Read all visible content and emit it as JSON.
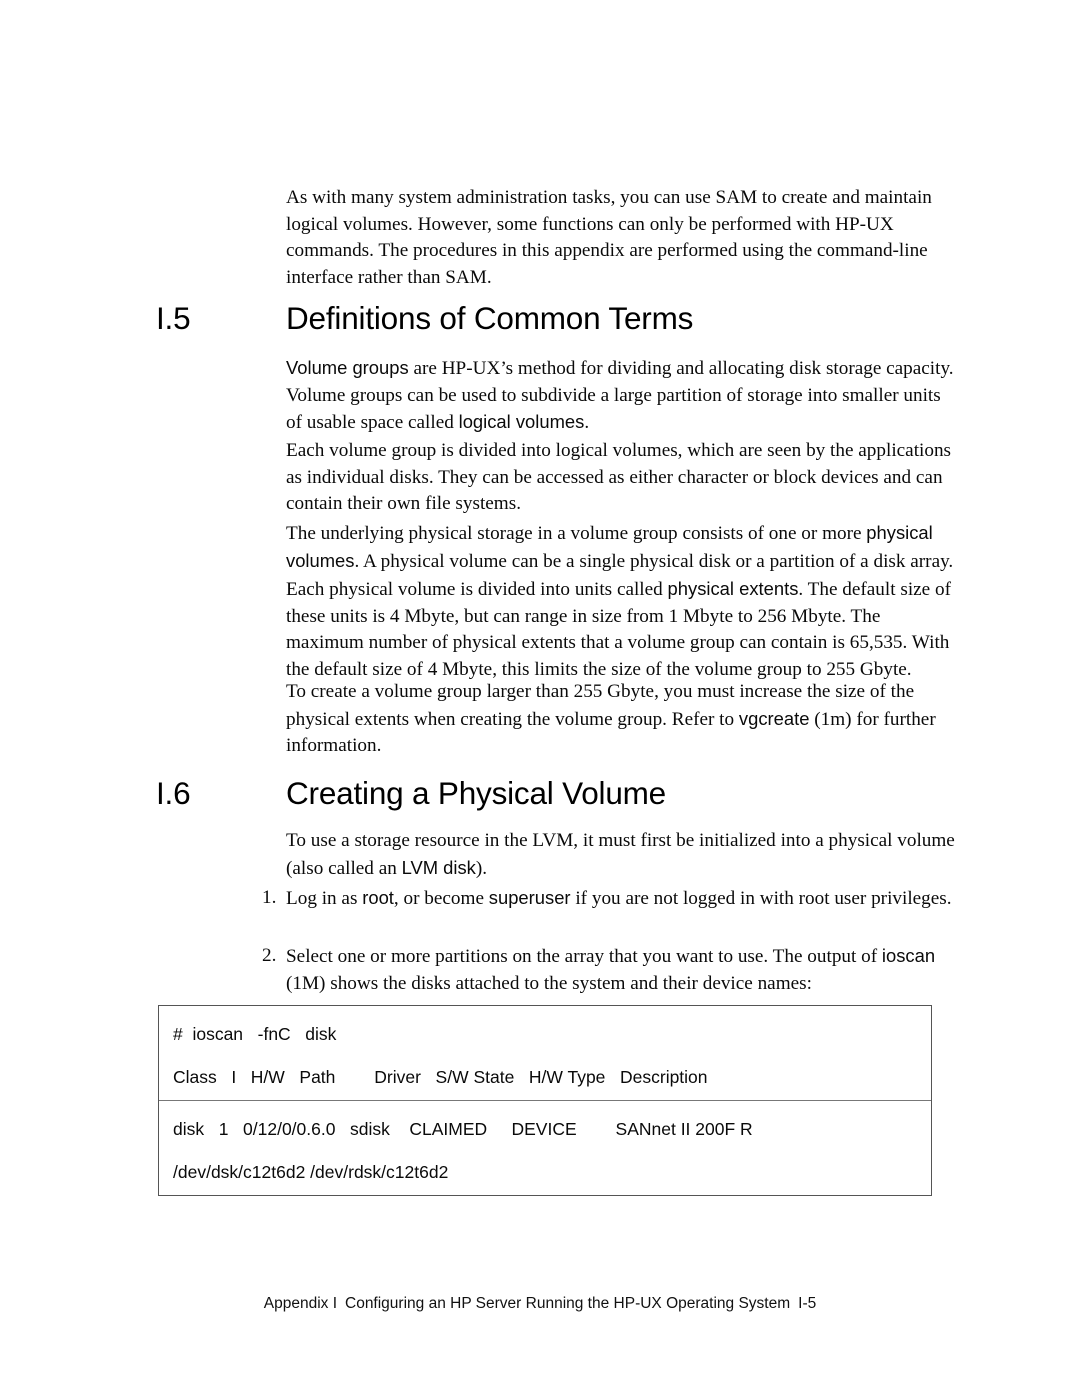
{
  "document": {
    "intro_paragraph": "As with many system administration tasks, you can use SAM to create and maintain logical volumes. However, some functions can only be performed with HP-UX commands. The procedures in this appendix are performed using the command-line interface rather than SAM."
  },
  "section_5": {
    "number": "I.5",
    "title": "Definitions of Common Terms",
    "p1": {
      "t1": "Volume groups",
      "s1": " are HP-UX’s method for dividing and allocating disk storage capacity. Volume groups can be used to subdivide a large partition of storage into smaller units of usable space called ",
      "t2": "logical volumes",
      "s2": "."
    },
    "p2": "Each volume group is divided into logical volumes, which are seen by the applications as individual disks. They can be accessed as either character or block devices and can contain their own file systems.",
    "p3": {
      "s1": "The underlying physical storage in a volume group consists of one or more ",
      "t1": "physical volumes",
      "s2": ". A physical volume can be a single physical disk or a partition of a disk array."
    },
    "p4": {
      "s1": "Each physical volume is divided into units called ",
      "t1": "physical extents",
      "s2": ". The default size of these units is 4 Mbyte, but can range in size from 1 Mbyte to 256 Mbyte. The maximum number of physical extents that a volume group can contain is 65,535. With the default size of 4 Mbyte, this limits the size of the volume group to 255 Gbyte."
    },
    "p5": {
      "s1": "To create a volume group larger than 255 Gbyte, you must increase the size of the physical extents when creating the volume group. Refer to ",
      "t1": "vgcreate",
      "s2": " (1m) for further information."
    }
  },
  "section_6": {
    "number": "I.6",
    "title": "Creating a Physical Volume",
    "p1": {
      "s1": "To use a storage resource in the LVM, it must first be initialized into a physical volume (also called an ",
      "t1": "LVM disk",
      "s2": ")."
    },
    "steps": [
      {
        "marker": "1.",
        "s1": "Log in as ",
        "t1": "root",
        "s2": ", or become ",
        "t2": "superuser",
        "s3": " if you are not logged in with root user privileges."
      },
      {
        "marker": "2.",
        "s1": "Select one or more partitions on the array that you want to use. The output of ",
        "t1": "ioscan",
        "s2": " (1M) shows the disks attached to the system and their device names:"
      }
    ]
  },
  "code_output": {
    "command_line": "#  ioscan   -fnC   disk",
    "header_line": "Class   I   H/W   Path        Driver   S/W State   H/W Type   Description",
    "device_line": "disk   1   0/12/0/0.6.0   sdisk    CLAIMED     DEVICE        SANnet II 200F R",
    "path_line": "/dev/dsk/c12t6d2 /dev/rdsk/c12t6d2"
  },
  "footer": {
    "appendix_label": "Appendix  I",
    "title": "Configuring an HP Server Running the HP-UX Operating System",
    "page_number": "I-5"
  }
}
